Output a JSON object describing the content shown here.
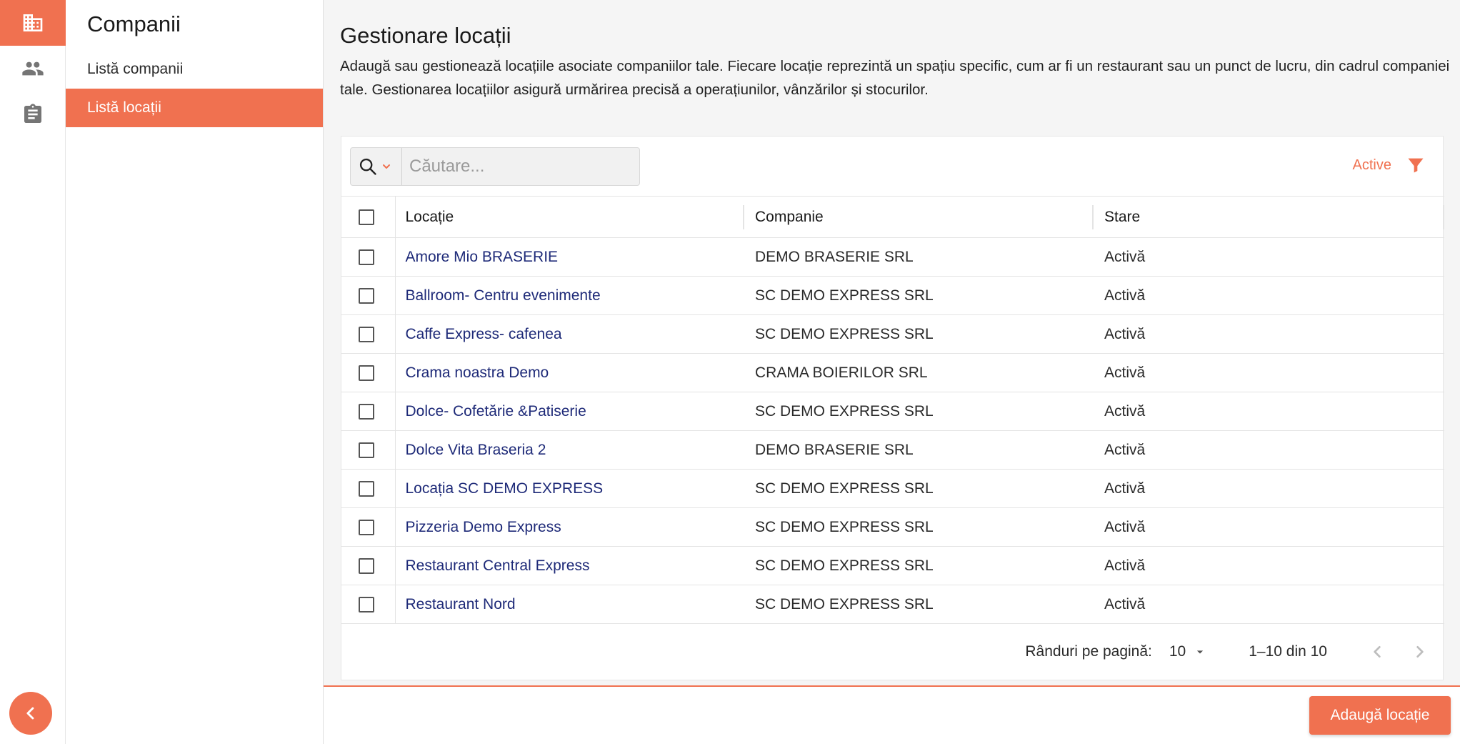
{
  "sidebar": {
    "title": "Companii",
    "items": [
      {
        "label": "Listă companii"
      },
      {
        "label": "Listă locații"
      }
    ]
  },
  "page": {
    "title": "Gestionare locații",
    "description": "Adaugă sau gestionează locațiile asociate companiilor tale. Fiecare locație reprezintă un spațiu specific, cum ar fi un restaurant sau un punct de lucru, din cadrul companiei tale. Gestionarea locațiilor asigură urmărirea precisă a operațiunilor, vânzărilor și stocurilor."
  },
  "search": {
    "placeholder": "Căutare..."
  },
  "filter": {
    "label": "Active"
  },
  "table": {
    "headers": {
      "location": "Locație",
      "company": "Companie",
      "status": "Stare"
    },
    "rows": [
      {
        "location": "Amore Mio BRASERIE",
        "company": "DEMO BRASERIE SRL",
        "status": "Activă"
      },
      {
        "location": "Ballroom- Centru evenimente",
        "company": "SC DEMO EXPRESS SRL",
        "status": "Activă"
      },
      {
        "location": "Caffe Express- cafenea",
        "company": "SC DEMO EXPRESS SRL",
        "status": "Activă"
      },
      {
        "location": "Crama noastra Demo",
        "company": "CRAMA BOIERILOR SRL",
        "status": "Activă"
      },
      {
        "location": "Dolce- Cofetărie &Patiserie",
        "company": "SC DEMO EXPRESS SRL",
        "status": "Activă"
      },
      {
        "location": "Dolce Vita Braseria 2",
        "company": "DEMO BRASERIE SRL",
        "status": "Activă"
      },
      {
        "location": "Locația SC DEMO EXPRESS",
        "company": "SC DEMO EXPRESS SRL",
        "status": "Activă"
      },
      {
        "location": "Pizzeria Demo Express",
        "company": "SC DEMO EXPRESS SRL",
        "status": "Activă"
      },
      {
        "location": "Restaurant Central Express",
        "company": "SC DEMO EXPRESS SRL",
        "status": "Activă"
      },
      {
        "location": "Restaurant Nord",
        "company": "SC DEMO EXPRESS SRL",
        "status": "Activă"
      }
    ]
  },
  "pagination": {
    "rows_per_page_label": "Rânduri pe pagină:",
    "rows_per_page": "10",
    "range": "1–10 din 10"
  },
  "actions": {
    "add_label": "Adaugă locație"
  },
  "icons": {
    "rail": [
      "building-icon",
      "people-icon",
      "clipboard-icon"
    ],
    "collapse": "chevron-left-icon",
    "search": "search-icon",
    "filter": "filter-icon"
  },
  "colors": {
    "accent": "#f07150",
    "link": "#1e2a78"
  }
}
